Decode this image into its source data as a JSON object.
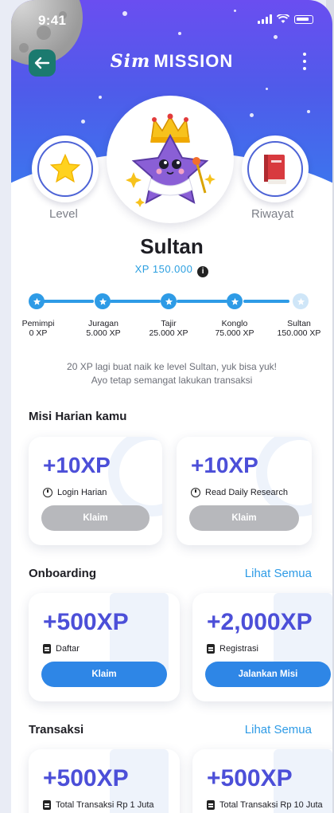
{
  "status_bar": {
    "time": "9:41"
  },
  "header": {
    "logo_prefix": "Sim",
    "logo_main": "MISSION"
  },
  "badges": {
    "left_label": "Level",
    "right_label": "Riwayat"
  },
  "profile": {
    "level_name": "Sultan",
    "xp_text": "XP 150.000"
  },
  "levels": [
    {
      "name": "Pemimpi",
      "xp": "0 XP"
    },
    {
      "name": "Juragan",
      "xp": "5.000 XP"
    },
    {
      "name": "Tajir",
      "xp": "25.000 XP"
    },
    {
      "name": "Konglo",
      "xp": "75.000 XP"
    },
    {
      "name": "Sultan",
      "xp": "150.000 XP"
    }
  ],
  "notice": {
    "line1": "20 XP lagi buat naik ke level Sultan, yuk bisa yuk!",
    "line2": "Ayo tetap semangat lakukan transaksi"
  },
  "daily": {
    "title": "Misi Harian kamu",
    "cards": [
      {
        "xp": "+10XP",
        "label": "Login Harian",
        "button": "Klaim"
      },
      {
        "xp": "+10XP",
        "label": "Read Daily Research",
        "button": "Klaim"
      }
    ]
  },
  "onboarding": {
    "title": "Onboarding",
    "see_all": "Lihat Semua",
    "cards": [
      {
        "xp": "+500XP",
        "label": "Daftar",
        "button": "Klaim"
      },
      {
        "xp": "+2,000XP",
        "label": "Registrasi",
        "button": "Jalankan Misi"
      }
    ]
  },
  "transaksi": {
    "title": "Transaksi",
    "see_all": "Lihat Semua",
    "cards": [
      {
        "xp": "+500XP",
        "label": "Total Transaksi Rp 1 Juta"
      },
      {
        "xp": "+500XP",
        "label": "Total Transaksi Rp 10 Juta"
      }
    ]
  },
  "colors": {
    "accent": "#2e9be6",
    "xp_purple": "#4c4fd8",
    "header_top": "#6a4ef0",
    "back_button": "#1b7a6f"
  }
}
